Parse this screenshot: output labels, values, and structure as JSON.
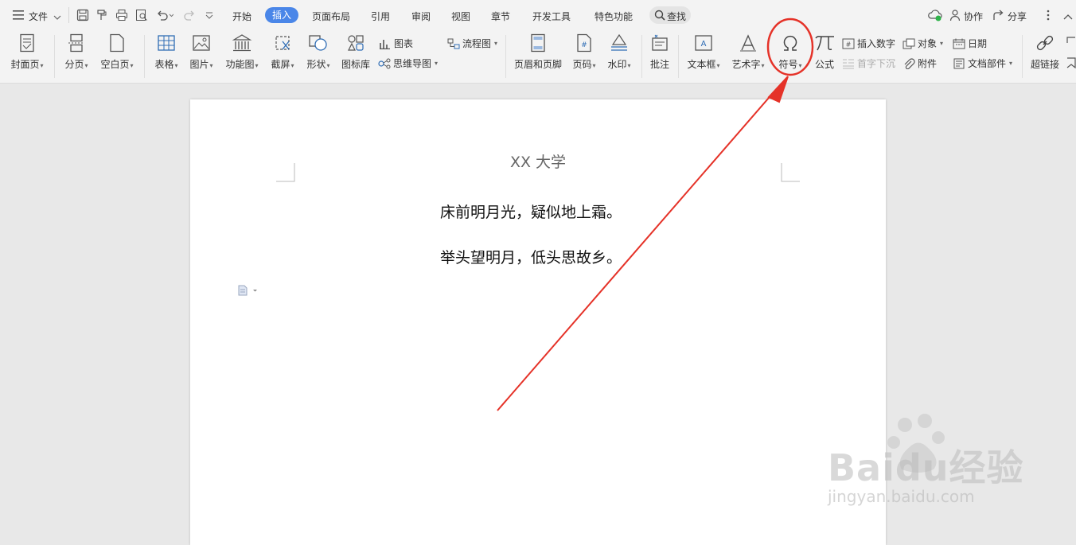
{
  "menubar": {
    "file_label": "文件",
    "tabs": [
      "开始",
      "插入",
      "页面布局",
      "引用",
      "审阅",
      "视图",
      "章节",
      "开发工具",
      "特色功能"
    ],
    "active_tab": "插入",
    "search_label": "查找",
    "collab_label": "协作",
    "share_label": "分享"
  },
  "ribbon": {
    "cover": "封面页",
    "page_break": "分页",
    "blank_page": "空白页",
    "table": "表格",
    "picture": "图片",
    "function_chart": "功能图",
    "screenshot": "截屏",
    "shapes": "形状",
    "icon_library": "图标库",
    "chart": "图表",
    "flowchart": "流程图",
    "mindmap": "思维导图",
    "header_footer": "页眉和页脚",
    "page_number": "页码",
    "watermark": "水印",
    "comment": "批注",
    "textbox": "文本框",
    "wordart": "艺术字",
    "symbol": "符号",
    "formula": "公式",
    "insert_number": "插入数字",
    "drop_cap": "首字下沉",
    "object": "对象",
    "attachment": "附件",
    "date": "日期",
    "doc_parts": "文档部件",
    "hyperlink": "超链接"
  },
  "document": {
    "title": "XX 大学",
    "lines": [
      "床前明月光，疑似地上霜。",
      "举头望明月，低头思故乡。"
    ]
  },
  "watermark": {
    "brand": "Baidu经验",
    "url": "jingyan.baidu.com"
  },
  "colors": {
    "active_tab": "#4a86e8",
    "annotation": "#e53228",
    "ribbon_bg": "#f3f3f3",
    "canvas_bg": "#e8e8e8"
  }
}
